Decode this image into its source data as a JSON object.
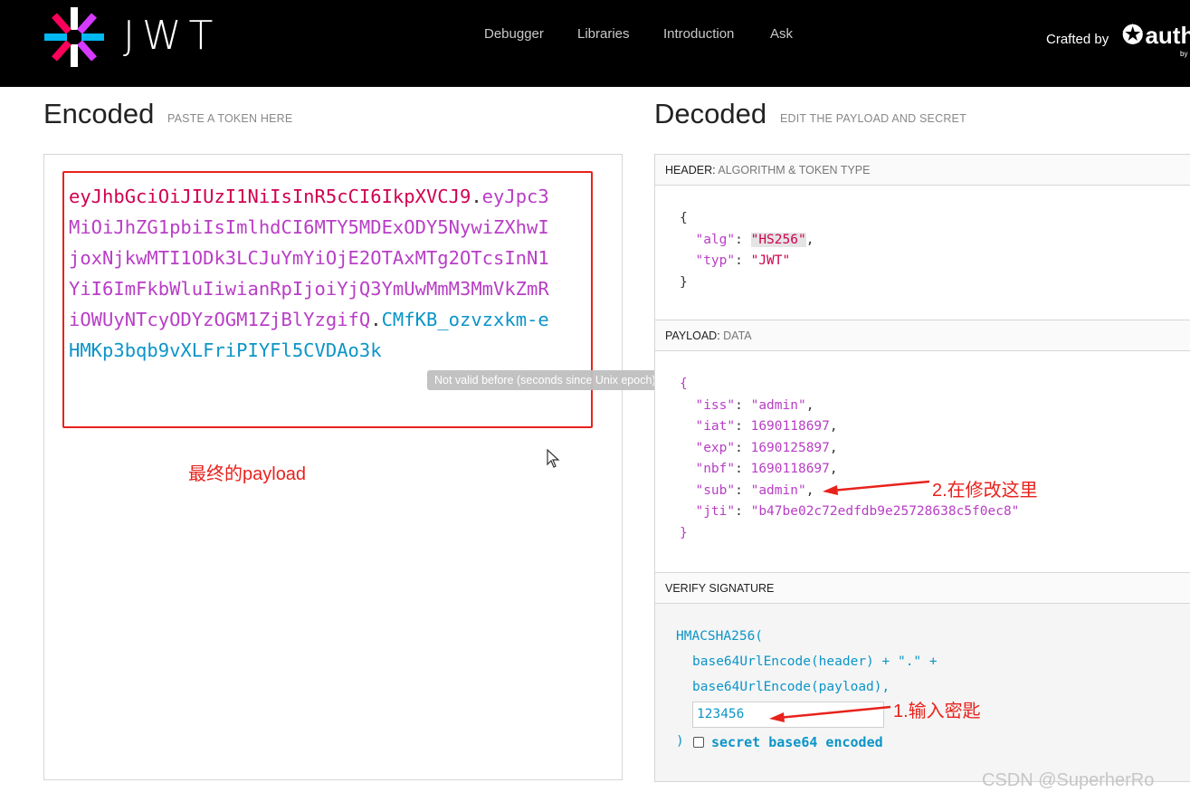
{
  "nav": {
    "logo_text": "JWT",
    "items": [
      "Debugger",
      "Libraries",
      "Introduction",
      "Ask"
    ],
    "crafted_by": "Crafted by",
    "brand": "auth",
    "brand_by": "by"
  },
  "encoded": {
    "title": "Encoded",
    "subtitle": "PASTE A TOKEN HERE",
    "header_part": "eyJhbGciOiJIUzI1NiIsInR5cCI6IkpXVCJ9",
    "payload_part": "eyJpc3MiOiJhZG1pbiIsImlhdCI6MTY5MDExODY5NywiZXhwIjoxNjkwMTI1ODk3LCJuYmYiOjE2OTAxMTg2OTcsInN1YiI6ImFkbWluIiwianRpIjoiYjQ3YmUwMmM3MmVkZmRiOWUyNTcyODYzOGM1ZjBlYzgifQ",
    "signature_part": "CMfKB_ozvzxkm-eHMKp3bqb9vXLFriPIYFl5CVDAo3k",
    "dot": ".",
    "tooltip": "Not valid before (seconds since Unix epoch)",
    "annotation": "最终的payload"
  },
  "decoded": {
    "title": "Decoded",
    "subtitle": "EDIT THE PAYLOAD AND SECRET",
    "header_label": "HEADER:",
    "header_desc": "ALGORITHM & TOKEN TYPE",
    "header_json": {
      "alg_key": "\"alg\"",
      "alg_val": "\"HS256\"",
      "typ_key": "\"typ\"",
      "typ_val": "\"JWT\""
    },
    "payload_label": "PAYLOAD:",
    "payload_desc": "DATA",
    "payload_json": {
      "iss_key": "\"iss\"",
      "iss_val": "\"admin\"",
      "iat_key": "\"iat\"",
      "iat_val": "1690118697",
      "exp_key": "\"exp\"",
      "exp_val": "1690125897",
      "nbf_key": "\"nbf\"",
      "nbf_val": "1690118697",
      "sub_key": "\"sub\"",
      "sub_val": "\"admin\"",
      "jti_key": "\"jti\"",
      "jti_val": "\"b47be02c72edfdb9e25728638c5f0ec8\""
    },
    "payload_annotation": "2.在修改这里",
    "verify_label": "VERIFY SIGNATURE",
    "verify_fn": "HMACSHA256(",
    "verify_line1": "base64UrlEncode(header) + \".\" +",
    "verify_line2": "base64UrlEncode(payload),",
    "secret_value": "123456",
    "secret_annotation": "1.输入密匙",
    "close_paren": ")",
    "base64_label": "secret base64 encoded"
  },
  "watermark": "CSDN @SuperherRo",
  "colors": {
    "header": "#d0004f",
    "payload": "#b83ec6",
    "signature": "#0b95c8",
    "annotation": "#e8221c"
  }
}
